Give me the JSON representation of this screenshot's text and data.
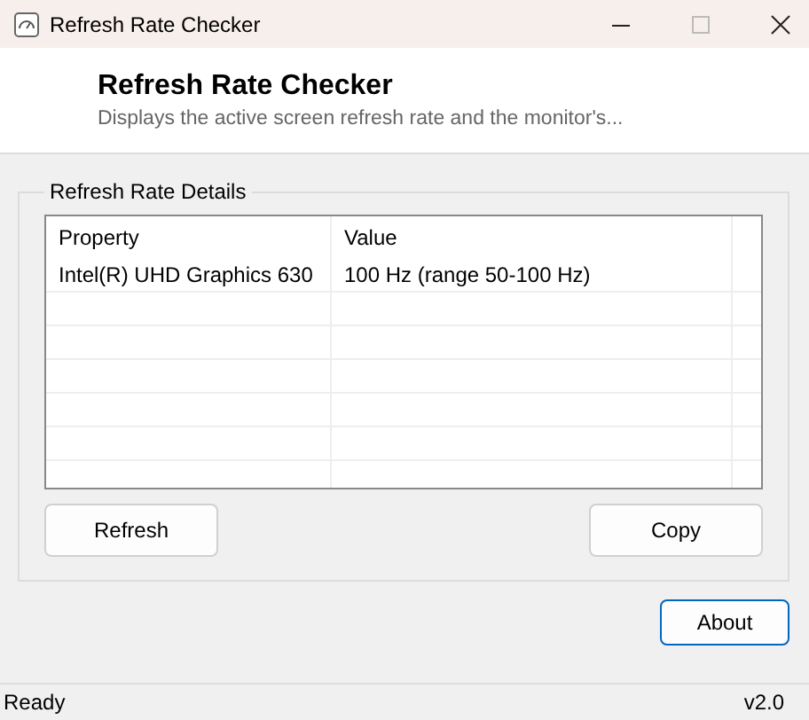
{
  "window": {
    "title": "Refresh Rate Checker"
  },
  "header": {
    "title": "Refresh Rate Checker",
    "subtitle": "Displays the active screen refresh rate and the monitor's..."
  },
  "group": {
    "title": "Refresh Rate Details",
    "table": {
      "columns": [
        "Property",
        "Value"
      ],
      "rows": [
        [
          "Intel(R) UHD Graphics 630",
          "100 Hz (range 50-100 Hz)"
        ]
      ]
    },
    "buttons": [
      {
        "label": "Refresh",
        "default": false
      },
      {
        "label": "Copy",
        "default": false
      }
    ]
  },
  "about_button": {
    "label": "About",
    "default": true
  },
  "status_bar": {
    "status": "Ready",
    "version": "v2.0"
  }
}
